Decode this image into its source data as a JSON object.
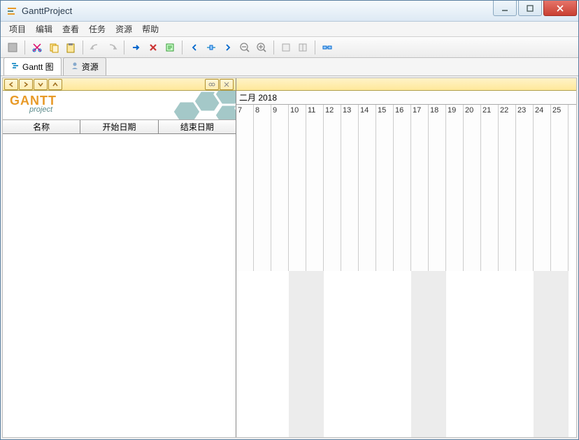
{
  "window": {
    "title": "GanttProject"
  },
  "menu": {
    "items": [
      "项目",
      "编辑",
      "查看",
      "任务",
      "资源",
      "帮助"
    ]
  },
  "tabs": {
    "gantt": "Gantt 图",
    "resources": "资源"
  },
  "columns": {
    "name": "名称",
    "start": "开始日期",
    "end": "结束日期"
  },
  "timeline": {
    "month_label": "二月 2018",
    "days": [
      7,
      8,
      9,
      10,
      11,
      12,
      13,
      14,
      15,
      16,
      17,
      18,
      19,
      20,
      21,
      22,
      23,
      24,
      25
    ],
    "weekend_indices": [
      3,
      4,
      10,
      11,
      17,
      18
    ]
  },
  "logo": {
    "brand": "GANTT",
    "sub": "project"
  }
}
